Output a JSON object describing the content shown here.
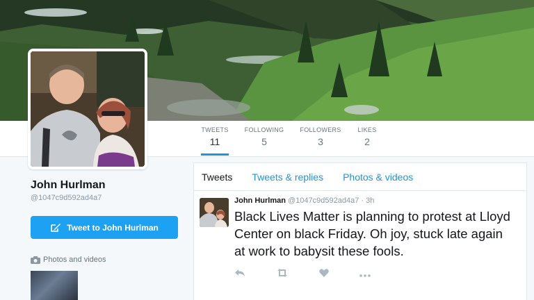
{
  "profile": {
    "name": "John Hurlman",
    "handle": "@1047c9d592ad4a7",
    "tweet_to_label": "Tweet to John Hurlman",
    "photos_label": "Photos and videos"
  },
  "stats": [
    {
      "label": "TWEETS",
      "value": "11"
    },
    {
      "label": "FOLLOWING",
      "value": "5"
    },
    {
      "label": "FOLLOWERS",
      "value": "3"
    },
    {
      "label": "LIKES",
      "value": "2"
    }
  ],
  "tabs": [
    {
      "label": "Tweets"
    },
    {
      "label": "Tweets & replies"
    },
    {
      "label": "Photos & videos"
    }
  ],
  "tweet": {
    "author": "John Hurlman",
    "handle": "@1047c9d592ad4a7",
    "separator": "·",
    "time": "3h",
    "text": "Black Lives Matter is planning to protest at Lloyd Center on black Friday. Oh joy, stuck late again at work to babysit these fools."
  },
  "icons": {
    "reply": "reply-icon",
    "retweet": "retweet-icon",
    "like": "heart-icon",
    "more": "more-icon",
    "camera": "camera-icon",
    "compose": "compose-icon"
  },
  "colors": {
    "accent": "#1b95e0",
    "button": "#1da1f2"
  }
}
